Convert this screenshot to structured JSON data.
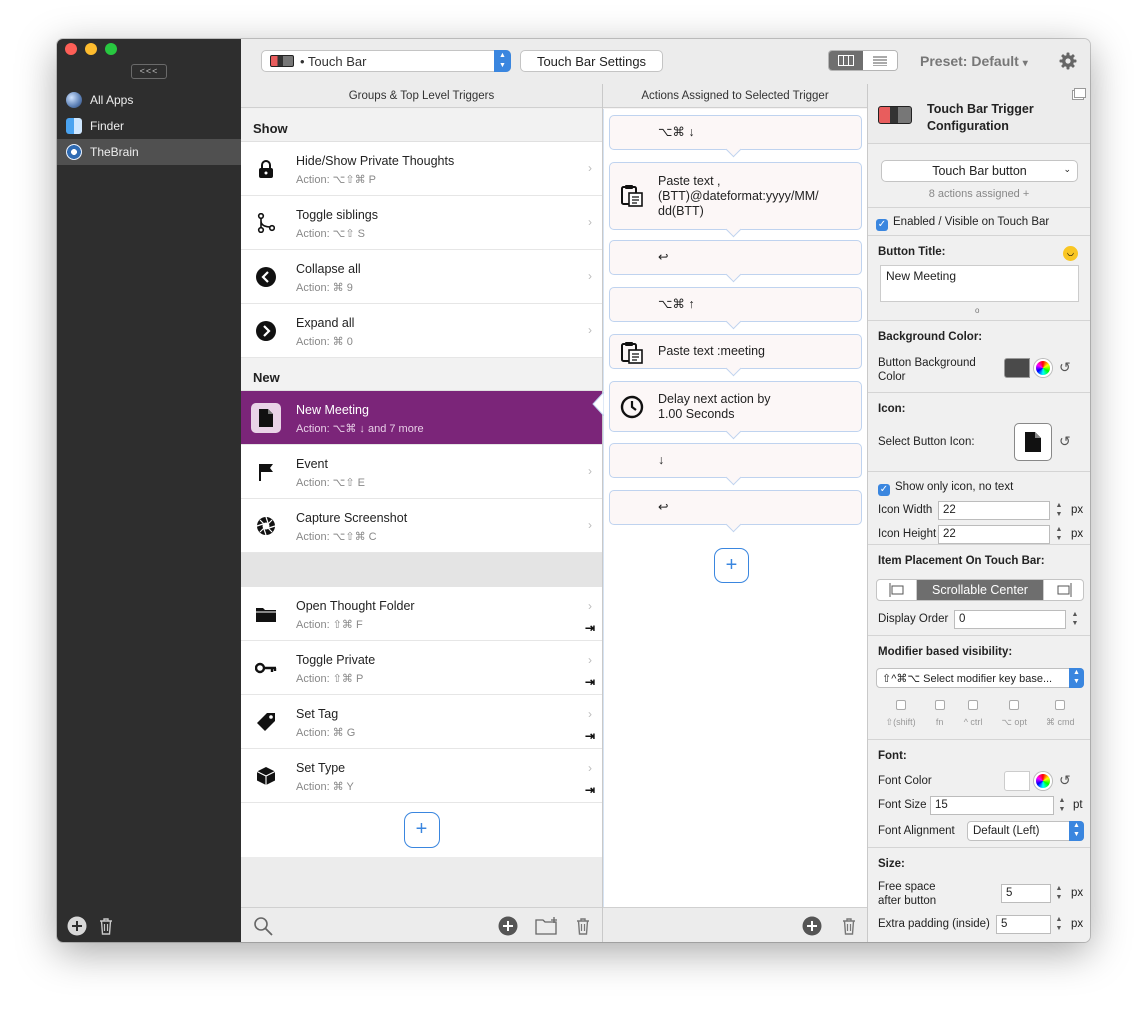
{
  "sidebar": {
    "collapse_label": "<<<",
    "apps": [
      {
        "name": "All Apps",
        "icon": "globe-icon"
      },
      {
        "name": "Finder",
        "icon": "finder-icon"
      },
      {
        "name": "TheBrain",
        "icon": "thebrain-icon"
      }
    ],
    "selected_app": "TheBrain"
  },
  "toolbar": {
    "device_select": "• Touch Bar",
    "settings_button": "Touch Bar Settings",
    "preset_label": "Preset: Default",
    "preset_arrow": "▾"
  },
  "groups": {
    "header": "Groups & Top Level Triggers",
    "sections": [
      {
        "title": "Show",
        "items": [
          {
            "name": "Hide/Show Private Thoughts",
            "action": "Action: ⌥⇧⌘ P",
            "icon": "lock-icon"
          },
          {
            "name": "Toggle siblings",
            "action": "Action: ⌥⇧ S",
            "icon": "branch-icon"
          },
          {
            "name": "Collapse all",
            "action": "Action: ⌘ 9",
            "icon": "chevron-left-circle-icon"
          },
          {
            "name": "Expand all",
            "action": "Action: ⌘ 0",
            "icon": "chevron-right-circle-icon"
          }
        ]
      },
      {
        "title": "New",
        "items": [
          {
            "name": "New Meeting",
            "action": "Action: ⌥⌘ ↓ and 7 more",
            "icon": "document-icon",
            "selected": true
          },
          {
            "name": "Event",
            "action": "Action: ⌥⇧ E",
            "icon": "flag-icon"
          },
          {
            "name": "Capture Screenshot",
            "action": "Action: ⌥⇧⌘ C",
            "icon": "aperture-icon"
          }
        ]
      }
    ],
    "passthrough_items": [
      {
        "name": "Open Thought Folder",
        "action": "Action: ⇧⌘ F",
        "icon": "folder-icon"
      },
      {
        "name": "Toggle Private",
        "action": "Action: ⇧⌘ P",
        "icon": "key-icon"
      },
      {
        "name": "Set Tag",
        "action": "Action: ⌘ G",
        "icon": "tag-icon"
      },
      {
        "name": "Set Type",
        "action": "Action: ⌘ Y",
        "icon": "cube-icon"
      }
    ],
    "add_label": "+"
  },
  "actions": {
    "header": "Actions Assigned to Selected Trigger",
    "items": [
      {
        "text": "⌥⌘ ↓",
        "icon": ""
      },
      {
        "text": "Paste text , (BTT)@dateformat:yyyy/MM/ dd(BTT)",
        "icon": "clipboard-icon"
      },
      {
        "text": "↩",
        "icon": ""
      },
      {
        "text": "⌥⌘ ↑",
        "icon": ""
      },
      {
        "text": "Paste text :meeting",
        "icon": "clipboard-icon"
      },
      {
        "text": "Delay next action by 1.00 Seconds",
        "icon": "clock-icon"
      },
      {
        "text": "↓",
        "icon": ""
      },
      {
        "text": "↩",
        "icon": ""
      }
    ],
    "add_label": "+"
  },
  "config": {
    "title_line1": "Touch Bar Trigger",
    "title_line2": "Configuration",
    "trigger_type": "Touch Bar button",
    "actions_assigned": "8 actions assigned +",
    "enabled_label": "Enabled / Visible on Touch Bar",
    "button_title_label": "Button Title:",
    "button_title_value": "New Meeting",
    "bg_color_heading": "Background Color:",
    "bg_color_label": "Button Background Color",
    "icon_heading": "Icon:",
    "select_icon_label": "Select Button Icon:",
    "show_only_icon_label": "Show only icon, no text",
    "icon_width_label": "Icon Width",
    "icon_width_value": "22",
    "icon_height_label": "Icon Height",
    "icon_height_value": "22",
    "px": "px",
    "pt": "pt",
    "placement_heading": "Item Placement On Touch Bar:",
    "placement_value": "Scrollable Center",
    "display_order_label": "Display Order",
    "display_order_value": "0",
    "modifier_heading": "Modifier based visibility:",
    "modifier_select": "⇧^⌘⌥ Select modifier key base...",
    "modifiers": [
      "⇧(shift)",
      "fn",
      "^ ctrl",
      "⌥ opt",
      "⌘ cmd"
    ],
    "font_heading": "Font:",
    "font_color_label": "Font Color",
    "font_size_label": "Font Size",
    "font_size_value": "15",
    "font_align_label": "Font Alignment",
    "font_align_value": "Default (Left)",
    "size_heading": "Size:",
    "free_space_label1": "Free space",
    "free_space_label2": "after button",
    "free_space_value": "5",
    "extra_padding_label": "Extra padding (inside)",
    "extra_padding_value": "5"
  },
  "colors": {
    "accent": "#3a86df",
    "selected_row": "#7b2579",
    "sidebar_bg": "#2e2e2e",
    "button_bg_color": "#4a4a4a"
  }
}
